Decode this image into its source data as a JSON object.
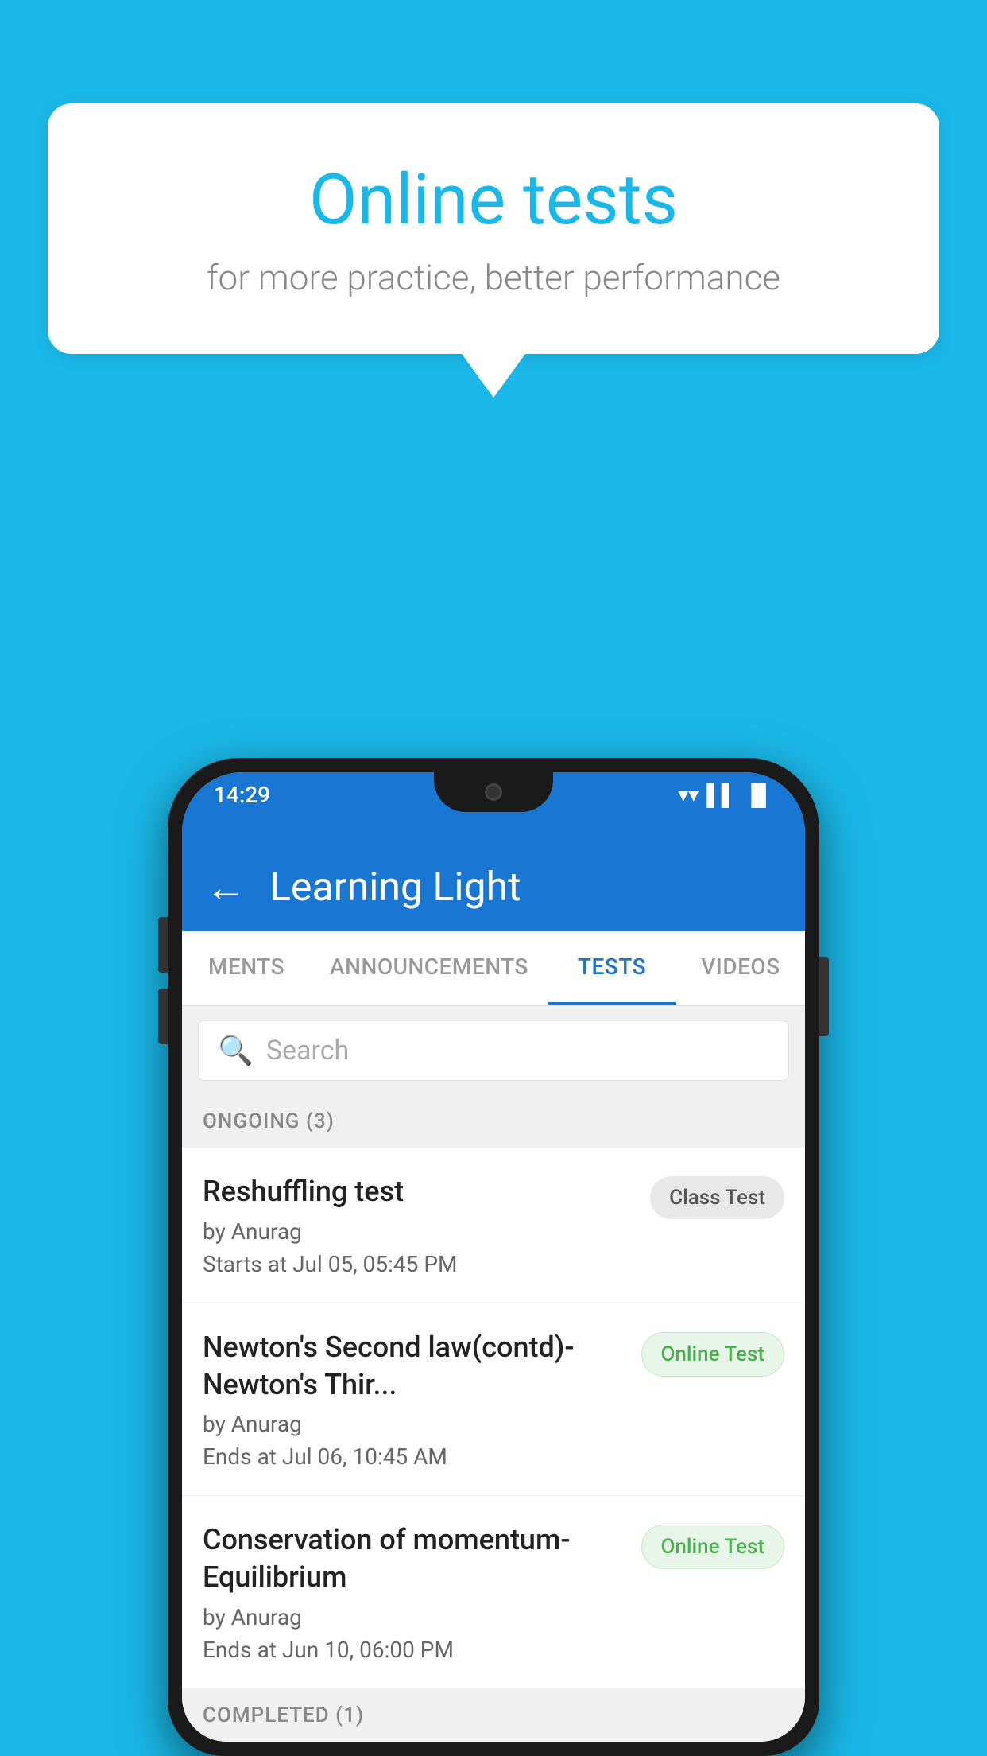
{
  "background_color": "#1ab8e8",
  "speech_bubble": {
    "title": "Online tests",
    "subtitle": "for more practice, better performance"
  },
  "phone": {
    "status_bar": {
      "time": "14:29",
      "wifi": "▼",
      "signal": "▲",
      "battery": "▮"
    },
    "app_bar": {
      "title": "Learning Light",
      "back_label": "←"
    },
    "tabs": [
      {
        "label": "MENTS",
        "active": false
      },
      {
        "label": "ANNOUNCEMENTS",
        "active": false
      },
      {
        "label": "TESTS",
        "active": true
      },
      {
        "label": "VIDEOS",
        "active": false
      }
    ],
    "search": {
      "placeholder": "Search"
    },
    "ongoing_section": {
      "label": "ONGOING (3)"
    },
    "test_items": [
      {
        "name": "Reshuffling test",
        "by": "by Anurag",
        "time": "Starts at  Jul 05, 05:45 PM",
        "badge": "Class Test",
        "badge_type": "class"
      },
      {
        "name": "Newton's Second law(contd)-Newton's Thir...",
        "by": "by Anurag",
        "time": "Ends at  Jul 06, 10:45 AM",
        "badge": "Online Test",
        "badge_type": "online"
      },
      {
        "name": "Conservation of momentum-Equilibrium",
        "by": "by Anurag",
        "time": "Ends at  Jun 10, 06:00 PM",
        "badge": "Online Test",
        "badge_type": "online"
      }
    ],
    "completed_section": {
      "label": "COMPLETED (1)"
    }
  }
}
